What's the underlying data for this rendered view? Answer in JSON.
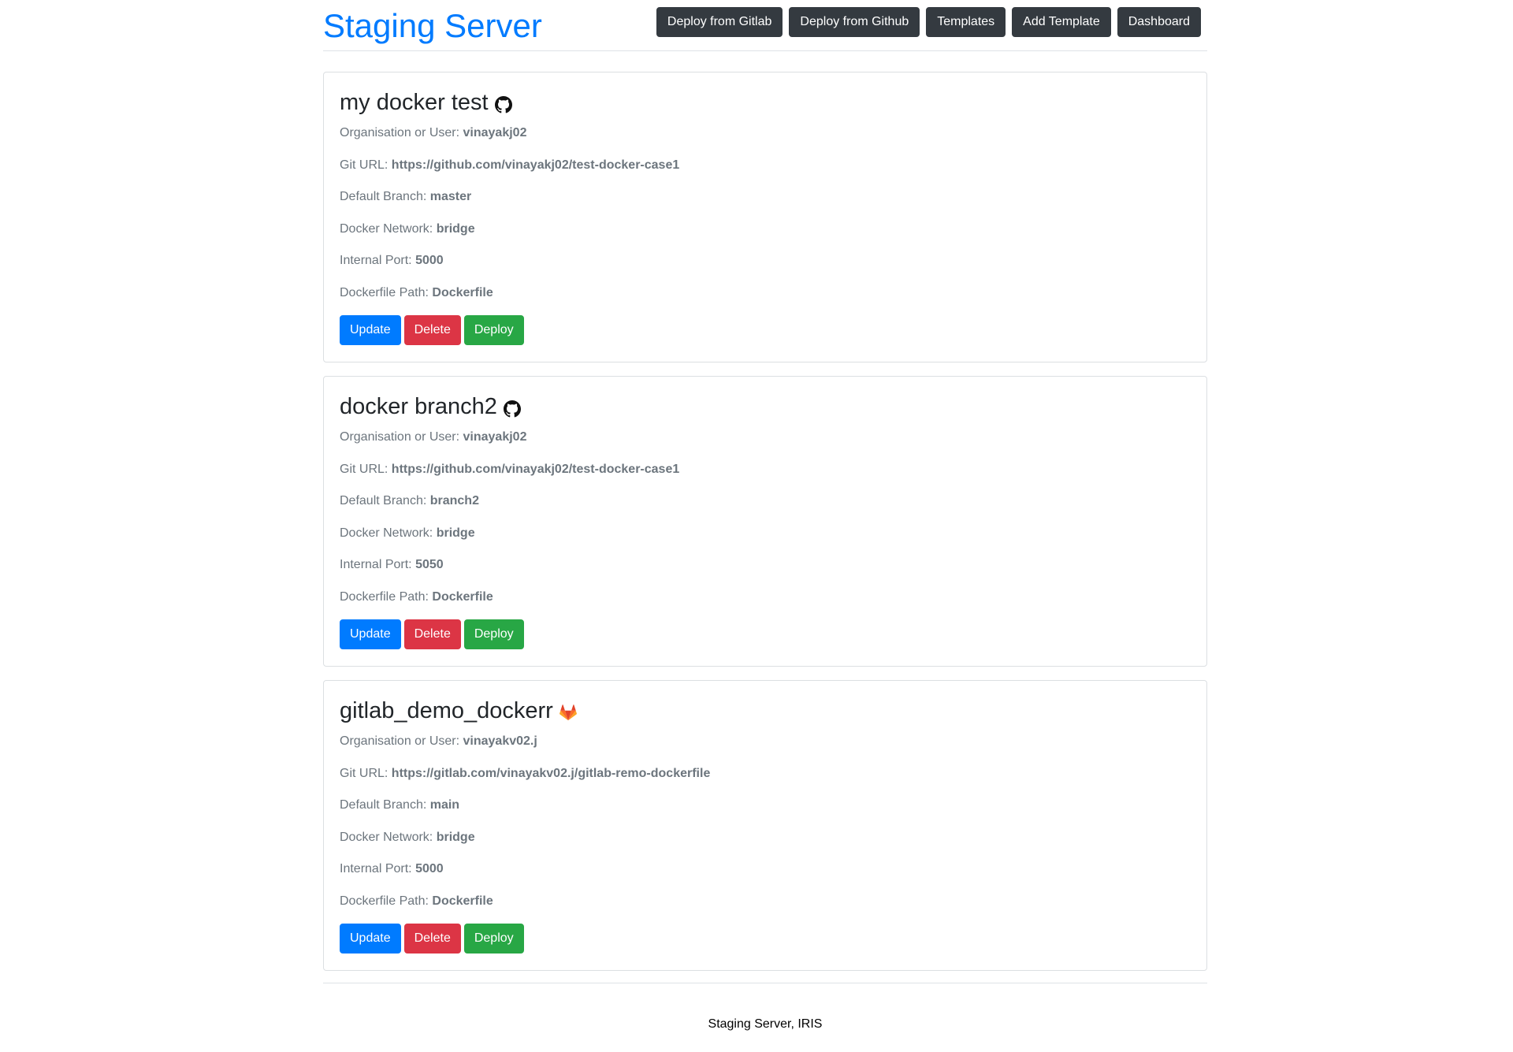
{
  "header": {
    "title": "Staging Server",
    "nav": [
      {
        "label": "Deploy from Gitlab"
      },
      {
        "label": "Deploy from Github"
      },
      {
        "label": "Templates"
      },
      {
        "label": "Add Template"
      },
      {
        "label": "Dashboard"
      }
    ]
  },
  "labels": {
    "org": "Organisation or User:",
    "git_url": "Git URL:",
    "branch": "Default Branch:",
    "network": "Docker Network:",
    "port": "Internal Port:",
    "dockerfile": "Dockerfile Path:"
  },
  "templates": [
    {
      "name": "my docker test",
      "source_icon": "github-icon",
      "org": "vinayakj02",
      "git_url": "https://github.com/vinayakj02/test-docker-case1",
      "branch": "master",
      "network": "bridge",
      "port": "5000",
      "dockerfile": "Dockerfile",
      "buttons": {
        "update": "Update",
        "delete": "Delete",
        "deploy": "Deploy"
      }
    },
    {
      "name": "docker branch2",
      "source_icon": "github-icon",
      "org": "vinayakj02",
      "git_url": "https://github.com/vinayakj02/test-docker-case1",
      "branch": "branch2",
      "network": "bridge",
      "port": "5050",
      "dockerfile": "Dockerfile",
      "buttons": {
        "update": "Update",
        "delete": "Delete",
        "deploy": "Deploy"
      }
    },
    {
      "name": "gitlab_demo_dockerr",
      "source_icon": "gitlab-icon",
      "org": "vinayakv02.j",
      "git_url": "https://gitlab.com/vinayakv02.j/gitlab-remo-dockerfile",
      "branch": "main",
      "network": "bridge",
      "port": "5000",
      "dockerfile": "Dockerfile",
      "buttons": {
        "update": "Update",
        "delete": "Delete",
        "deploy": "Deploy"
      }
    }
  ],
  "footer": {
    "text": "Staging Server, IRIS"
  },
  "colors": {
    "brand": "#007bff",
    "nav_button": "#343a40",
    "update": "#007bff",
    "delete": "#dc3545",
    "deploy": "#28a745",
    "gitlab_orange": "#e24329"
  }
}
